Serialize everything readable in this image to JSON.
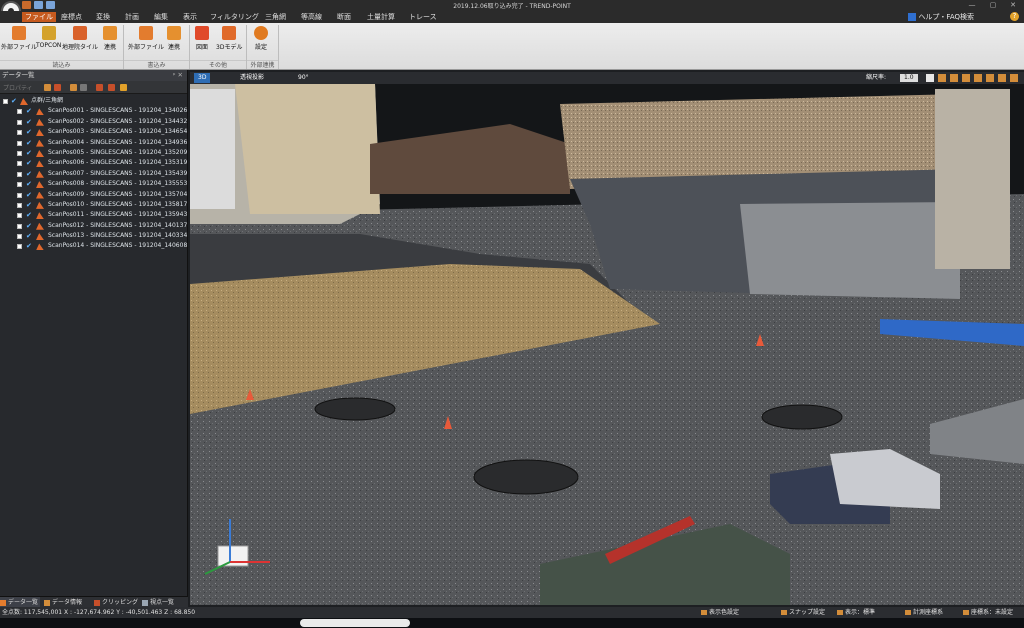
{
  "window": {
    "title": "2019.12.06取り込み完了 - TREND-POINT",
    "minimize": "—",
    "maximize": "▢",
    "close": "✕"
  },
  "menu": {
    "items": [
      "ファイル",
      "座標点",
      "変換",
      "計画",
      "編集",
      "表示",
      "フィルタリング",
      "三角網",
      "等高線",
      "断面",
      "土量計算",
      "トレース"
    ],
    "active_index": 0,
    "help_label": "ヘルプ・FAQ検索",
    "help_mark": "?"
  },
  "ribbon": {
    "buttons": [
      {
        "label": "外部ファイル",
        "icon": "file-import-icon",
        "color": "#e37c2e"
      },
      {
        "label": "TOPCON",
        "icon": "topcon-scanner-icon",
        "color": "#d4a22c"
      },
      {
        "label": "地理院タイル",
        "icon": "map-tile-icon",
        "color": "#d9622b"
      },
      {
        "label": "連携",
        "icon": "link-icon",
        "color": "#e5902f"
      },
      {
        "label": "外部ファイル",
        "icon": "file-export-icon",
        "color": "#e37c2e"
      },
      {
        "label": "連携",
        "icon": "link-export-icon",
        "color": "#e5902f"
      },
      {
        "label": "図面",
        "icon": "cad-icon",
        "color": "#e04a2a"
      },
      {
        "label": "3Dモデル",
        "icon": "3d-model-icon",
        "color": "#e06a2a"
      },
      {
        "label": "設定",
        "icon": "gear-icon",
        "color": "#e07a20"
      }
    ],
    "groups": [
      "読込み",
      "書込み",
      "その他",
      "外部連携"
    ]
  },
  "panel": {
    "title": "データ一覧",
    "pin": "ᵖ ✕",
    "toolbar_label": "プロパティ",
    "root_label": "点群/三角網",
    "scans": [
      "ScanPos001 - SINGLESCANS - 191204_134026",
      "ScanPos002 - SINGLESCANS - 191204_134432",
      "ScanPos003 - SINGLESCANS - 191204_134654",
      "ScanPos004 - SINGLESCANS - 191204_134936",
      "ScanPos005 - SINGLESCANS - 191204_135209",
      "ScanPos006 - SINGLESCANS - 191204_135319",
      "ScanPos007 - SINGLESCANS - 191204_135439",
      "ScanPos008 - SINGLESCANS - 191204_135553",
      "ScanPos009 - SINGLESCANS - 191204_135704",
      "ScanPos010 - SINGLESCANS - 191204_135817",
      "ScanPos011 - SINGLESCANS - 191204_135943",
      "ScanPos012 - SINGLESCANS - 191204_140137",
      "ScanPos013 - SINGLESCANS - 191204_140334",
      "ScanPos014 - SINGLESCANS - 191204_140608"
    ],
    "tabs": [
      "データ一覧",
      "データ情報",
      "クリッピング",
      "視点一覧"
    ]
  },
  "view": {
    "tabs": [
      "3D",
      "透視投影",
      "90°"
    ],
    "scale_label": "縮尺率:",
    "scale_value": "1.0"
  },
  "status": {
    "coords": "全点数: 117,545,001   X : -127,674.962  Y : -40,501.463  Z : 68.850",
    "items": [
      "表示色設定",
      "スナップ設定",
      "表示：標準",
      "計測座標系",
      "座標系：未設定"
    ]
  }
}
